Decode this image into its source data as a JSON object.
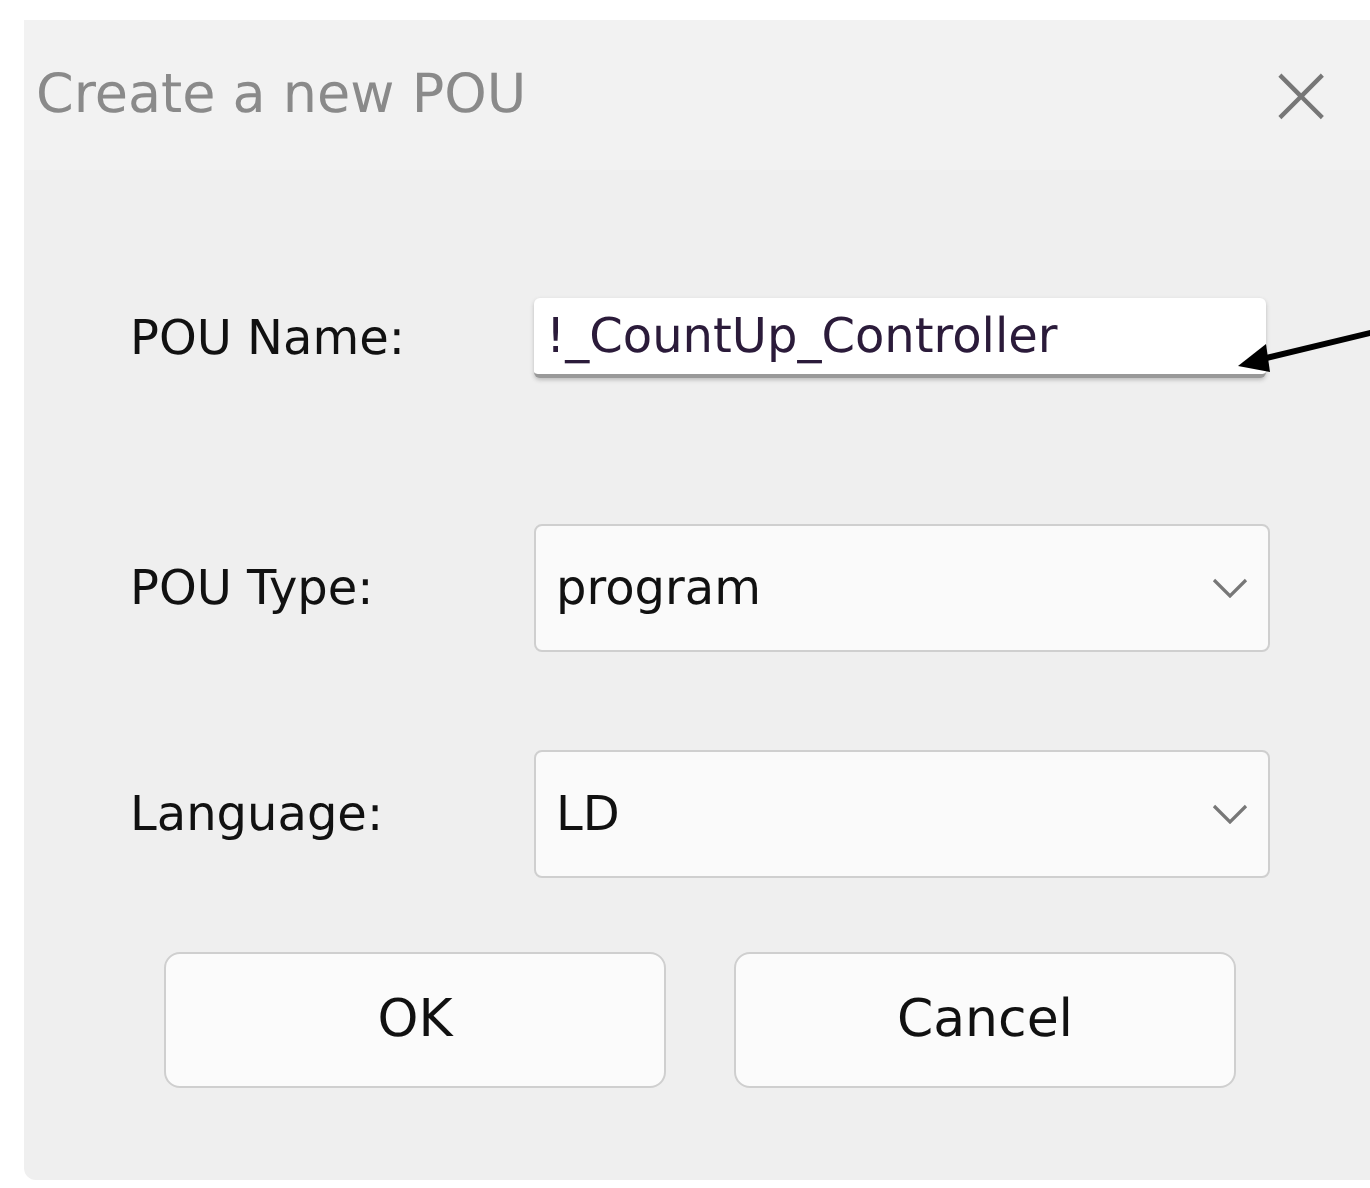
{
  "window": {
    "title": "Create a new POU",
    "close": "×"
  },
  "fields": [
    {
      "kind": "text",
      "label": "POU Name:",
      "value": "!_CountUp_Controller"
    },
    {
      "kind": "combo",
      "label": "POU Type:",
      "value": "program"
    },
    {
      "kind": "combo",
      "label": "Language:",
      "value": "LD"
    }
  ],
  "buttons": [
    "OK",
    "Cancel"
  ]
}
